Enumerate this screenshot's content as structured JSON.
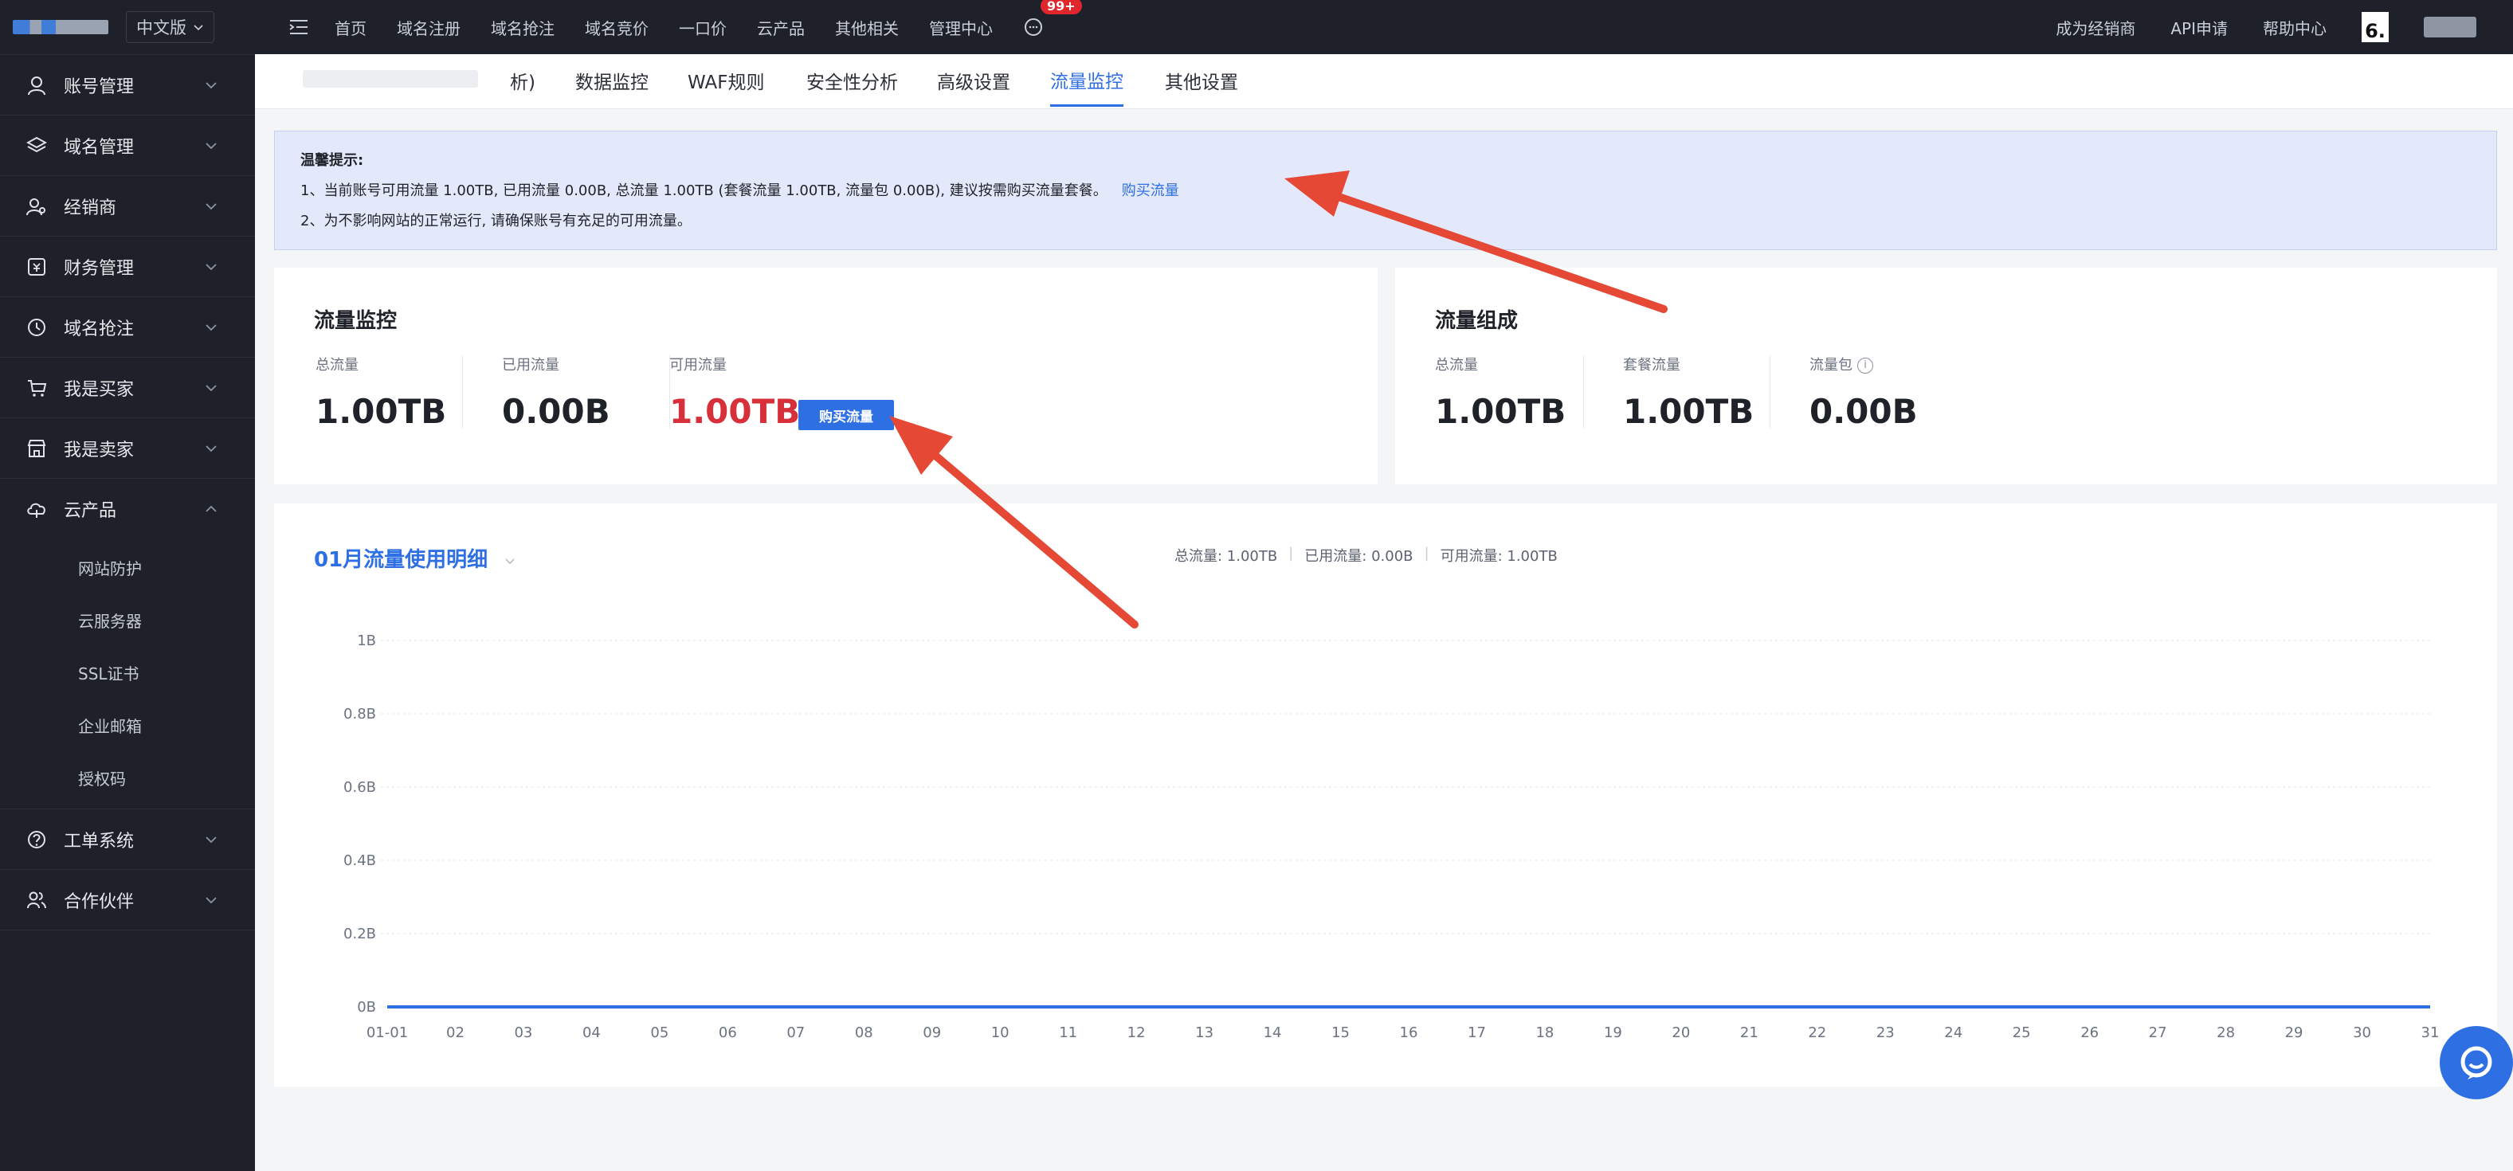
{
  "sidebar": {
    "lang": "中文版",
    "items": [
      {
        "label": "账号管理",
        "icon": "user-icon"
      },
      {
        "label": "域名管理",
        "icon": "layers-icon"
      },
      {
        "label": "经销商",
        "icon": "users-icon"
      },
      {
        "label": "财务管理",
        "icon": "finance-icon"
      },
      {
        "label": "域名抢注",
        "icon": "clock-icon"
      },
      {
        "label": "我是买家",
        "icon": "cart-icon"
      },
      {
        "label": "我是卖家",
        "icon": "store-icon"
      },
      {
        "label": "云产品",
        "icon": "cloud-icon"
      }
    ],
    "sub_items": [
      "网站防护",
      "云服务器",
      "SSL证书",
      "企业邮箱",
      "授权码"
    ],
    "bottom_items": [
      {
        "label": "工单系统",
        "icon": "question-icon"
      },
      {
        "label": "合作伙伴",
        "icon": "partner-icon"
      }
    ]
  },
  "topbar": {
    "nav": [
      "首页",
      "域名注册",
      "域名抢注",
      "域名竞价",
      "一口价",
      "云产品",
      "其他相关",
      "管理中心"
    ],
    "badge": "99+",
    "right": [
      "成为经销商",
      "API申请",
      "帮助中心"
    ],
    "avatar_text": "6."
  },
  "tabs": {
    "items": [
      "析)",
      "数据监控",
      "WAF规则",
      "安全性分析",
      "高级设置",
      "流量监控",
      "其他设置"
    ],
    "active": "流量监控"
  },
  "notice": {
    "title": "温馨提示:",
    "line1": "1、当前账号可用流量 1.00TB, 已用流量 0.00B, 总流量 1.00TB (套餐流量 1.00TB, 流量包 0.00B), 建议按需购买流量套餐。",
    "link": "购买流量",
    "line2": "2、为不影响网站的正常运行, 请确保账号有充足的可用流量。"
  },
  "monitor": {
    "title": "流量监控",
    "total_label": "总流量",
    "total": "1.00TB",
    "used_label": "已用流量",
    "used": "0.00B",
    "avail_label": "可用流量",
    "avail": "1.00TB",
    "buy": "购买流量"
  },
  "composition": {
    "title": "流量组成",
    "total_label": "总流量",
    "total": "1.00TB",
    "plan_label": "套餐流量",
    "plan": "1.00TB",
    "pack_label": "流量包",
    "pack": "0.00B"
  },
  "chart": {
    "title": "01月流量使用明细",
    "sub_total": "总流量: 1.00TB",
    "sub_used": "已用流量: 0.00B",
    "sub_avail": "可用流量: 1.00TB"
  },
  "chart_data": {
    "type": "line",
    "x": [
      "01-01",
      "02",
      "03",
      "04",
      "05",
      "06",
      "07",
      "08",
      "09",
      "10",
      "11",
      "12",
      "13",
      "14",
      "15",
      "16",
      "17",
      "18",
      "19",
      "20",
      "21",
      "22",
      "23",
      "24",
      "25",
      "26",
      "27",
      "28",
      "29",
      "30",
      "31"
    ],
    "series": [
      {
        "values": [
          0,
          0,
          0,
          0,
          0,
          0,
          0,
          0,
          0,
          0,
          0,
          0,
          0,
          0,
          0,
          0,
          0,
          0,
          0,
          0,
          0,
          0,
          0,
          0,
          0,
          0,
          0,
          0,
          0,
          0,
          0
        ]
      }
    ],
    "yticks": [
      "0B",
      "0.2B",
      "0.4B",
      "0.6B",
      "0.8B",
      "1B"
    ],
    "ylim": [
      0,
      1
    ],
    "grid": true,
    "color": "#2f6fe4"
  }
}
